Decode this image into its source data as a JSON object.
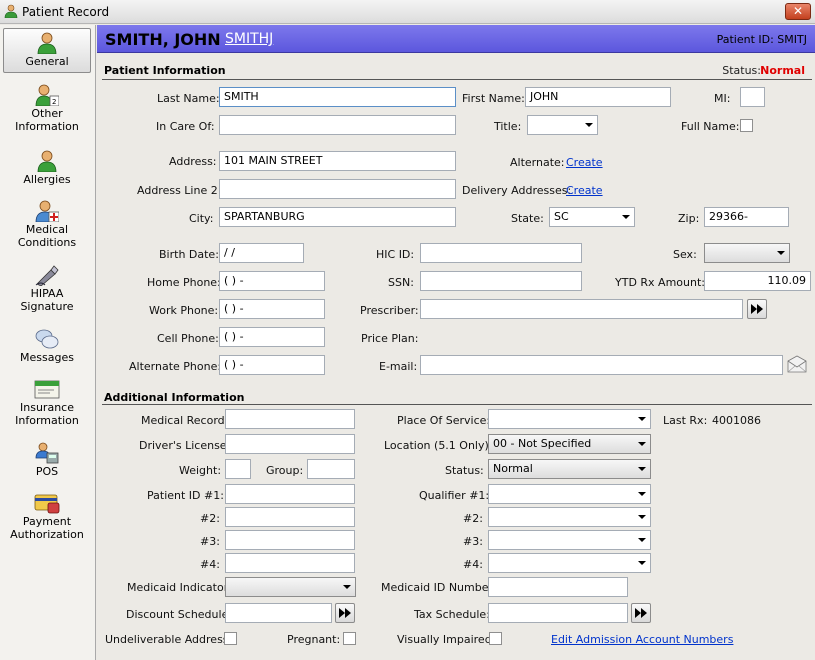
{
  "window": {
    "title": "Patient Record",
    "close_label": "✕"
  },
  "sidebar": {
    "items": [
      {
        "label": "General"
      },
      {
        "label": "Other Information"
      },
      {
        "label": "Allergies"
      },
      {
        "label": "Medical Conditions"
      },
      {
        "label": "HIPAA Signature"
      },
      {
        "label": "Messages"
      },
      {
        "label": "Insurance Information"
      },
      {
        "label": "POS"
      },
      {
        "label": "Payment Authorization"
      }
    ]
  },
  "header": {
    "name": "SMITH, JOHN",
    "code_link": "SMITHJ",
    "patient_id": "Patient ID: SMITJ"
  },
  "patient_info": {
    "section_title": "Patient Information",
    "status_label": "Status:",
    "status_value": "Normal",
    "last_name": {
      "label": "Last Name:",
      "value": "SMITH"
    },
    "first_name": {
      "label": "First Name:",
      "value": "JOHN"
    },
    "mi": {
      "label": "MI:",
      "value": ""
    },
    "in_care_of": {
      "label": "In Care Of:",
      "value": ""
    },
    "title": {
      "label": "Title:",
      "value": ""
    },
    "full_name": {
      "label": "Full Name:"
    },
    "address": {
      "label": "Address:",
      "value": "101 MAIN STREET"
    },
    "alternate": {
      "label": "Alternate:",
      "link": "Create"
    },
    "address2": {
      "label": "Address Line 2:",
      "value": ""
    },
    "delivery": {
      "label": "Delivery Addresses:",
      "link": "Create"
    },
    "city": {
      "label": "City:",
      "value": "SPARTANBURG"
    },
    "state": {
      "label": "State:",
      "value": "SC"
    },
    "zip": {
      "label": "Zip:",
      "value": "29366-"
    },
    "birth_date": {
      "label": "Birth Date:",
      "value": " / /"
    },
    "hic_id": {
      "label": "HIC ID:",
      "value": ""
    },
    "sex": {
      "label": "Sex:",
      "value": ""
    },
    "home_phone": {
      "label": "Home Phone:",
      "value": "(  )   -"
    },
    "ssn": {
      "label": "SSN:",
      "value": ""
    },
    "ytd_rx": {
      "label": "YTD Rx Amount:",
      "value": "110.09"
    },
    "work_phone": {
      "label": "Work Phone:",
      "value": "(  )   -"
    },
    "prescriber": {
      "label": "Prescriber:",
      "value": ""
    },
    "cell_phone": {
      "label": "Cell Phone:",
      "value": "(  )   -"
    },
    "price_plan": {
      "label": "Price Plan:"
    },
    "alt_phone": {
      "label": "Alternate Phone:",
      "value": "(  )   -"
    },
    "email": {
      "label": "E-mail:",
      "value": ""
    }
  },
  "additional_info": {
    "section_title": "Additional Information",
    "medical_record": {
      "label": "Medical Record:",
      "value": ""
    },
    "place_of_service": {
      "label": "Place Of Service:",
      "value": ""
    },
    "last_rx": {
      "label": "Last Rx:",
      "value": "4001086"
    },
    "drivers_license": {
      "label": "Driver's License:",
      "value": ""
    },
    "location": {
      "label": "Location (5.1 Only):",
      "value": "00 - Not Specified"
    },
    "weight": {
      "label": "Weight:",
      "value": ""
    },
    "group": {
      "label": "Group:",
      "value": ""
    },
    "status": {
      "label": "Status:",
      "value": "Normal"
    },
    "patient_id1": {
      "label": "Patient ID #1:",
      "value": ""
    },
    "qualifier1": {
      "label": "Qualifier #1:",
      "value": ""
    },
    "id2": {
      "label": "#2:",
      "value": ""
    },
    "q2": {
      "label": "#2:",
      "value": ""
    },
    "id3": {
      "label": "#3:",
      "value": ""
    },
    "q3": {
      "label": "#3:",
      "value": ""
    },
    "id4": {
      "label": "#4:",
      "value": ""
    },
    "q4": {
      "label": "#4:",
      "value": ""
    },
    "medicaid_indicator": {
      "label": "Medicaid Indicator:",
      "value": ""
    },
    "medicaid_id": {
      "label": "Medicaid ID Number:",
      "value": ""
    },
    "discount_schedule": {
      "label": "Discount Schedule:",
      "value": ""
    },
    "tax_schedule": {
      "label": "Tax Schedule:",
      "value": ""
    },
    "undeliverable": {
      "label": "Undeliverable Address:"
    },
    "pregnant": {
      "label": "Pregnant:"
    },
    "visually_impaired": {
      "label": "Visually Impaired:"
    },
    "edit_admission_link": "Edit Admission Account Numbers"
  }
}
